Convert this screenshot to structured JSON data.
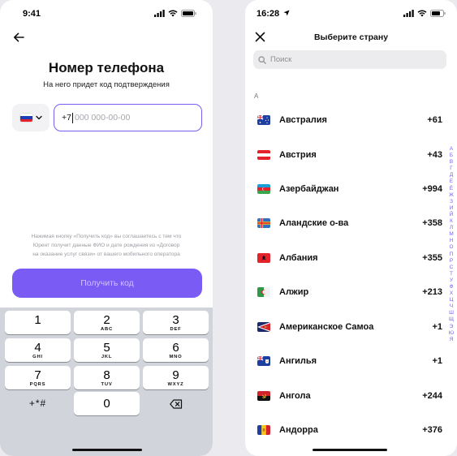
{
  "left": {
    "status": {
      "time": "9:41"
    },
    "title": "Номер телефона",
    "subtitle": "На него придет код подтверждения",
    "phone_input": {
      "prefix": "+7",
      "placeholder": "000 000-00-00"
    },
    "consent": [
      "Нажимая кнопку «Получить код» вы соглашаетесь с тем что",
      "Юрент получит данные ФИО и дате рождения из «Договор",
      "на оказание услуг связи» от вашего мобильного оператора"
    ],
    "submit_label": "Получить код",
    "keyboard": {
      "keys": [
        {
          "digit": "1",
          "letters": ""
        },
        {
          "digit": "2",
          "letters": "ABC"
        },
        {
          "digit": "3",
          "letters": "DEF"
        },
        {
          "digit": "4",
          "letters": "GHI"
        },
        {
          "digit": "5",
          "letters": "JKL"
        },
        {
          "digit": "6",
          "letters": "MNO"
        },
        {
          "digit": "7",
          "letters": "PQRS"
        },
        {
          "digit": "8",
          "letters": "TUV"
        },
        {
          "digit": "9",
          "letters": "WXYZ"
        }
      ],
      "symbols": "+*#",
      "zero": "0"
    }
  },
  "right": {
    "status": {
      "time": "16:28"
    },
    "title": "Выберите страну",
    "search_placeholder": "Поиск",
    "section_letter": "А",
    "countries": [
      {
        "name": "Австралия",
        "code": "+61",
        "flag": "australia-flag"
      },
      {
        "name": "Австрия",
        "code": "+43",
        "flag": "austria-flag"
      },
      {
        "name": "Азербайджан",
        "code": "+994",
        "flag": "azerbaijan-flag"
      },
      {
        "name": "Аландские о-ва",
        "code": "+358",
        "flag": "aland-flag"
      },
      {
        "name": "Албания",
        "code": "+355",
        "flag": "albania-flag"
      },
      {
        "name": "Алжир",
        "code": "+213",
        "flag": "algeria-flag"
      },
      {
        "name": "Американское Самоа",
        "code": "+1",
        "flag": "american-samoa-flag"
      },
      {
        "name": "Ангилья",
        "code": "+1",
        "flag": "anguilla-flag"
      },
      {
        "name": "Ангола",
        "code": "+244",
        "flag": "angola-flag"
      },
      {
        "name": "Андорра",
        "code": "+376",
        "flag": "andorra-flag"
      }
    ],
    "index_letters": [
      "А",
      "Б",
      "В",
      "Г",
      "Д",
      "Е",
      "Ё",
      "Ж",
      "З",
      "И",
      "Й",
      "К",
      "Л",
      "М",
      "Н",
      "О",
      "П",
      "Р",
      "С",
      "Т",
      "У",
      "Ф",
      "Х",
      "Ц",
      "Ч",
      "Ш",
      "Щ",
      "Э",
      "Ю",
      "Я"
    ]
  },
  "colors": {
    "accent": "#7a5cf5",
    "button_text": "#cfc3ff",
    "keyboard_bg": "#d1d4db"
  }
}
